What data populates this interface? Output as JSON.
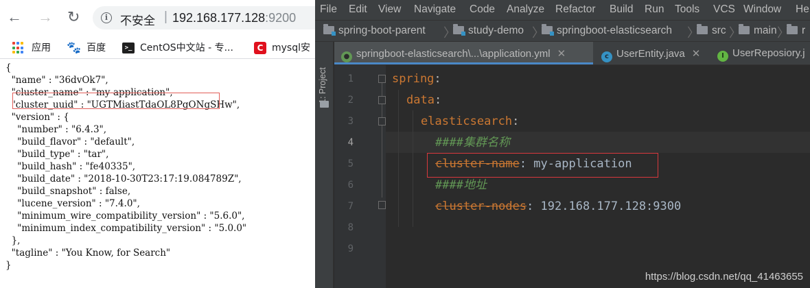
{
  "browser": {
    "nav": {
      "back": "←",
      "forward": "→",
      "reload": "↻"
    },
    "omnibox": {
      "security_label": "不安全",
      "separator": "|",
      "host": "192.168.177.128",
      "port": ":9200"
    },
    "bookmarks": [
      {
        "label": "应用",
        "icon": "apps-grid-icon"
      },
      {
        "label": "百度",
        "icon": "baidu-paw-icon"
      },
      {
        "label": "CentOS中文站 - 专...",
        "icon": "terminal-icon"
      },
      {
        "label": "mysql安",
        "icon": "csdn-icon"
      }
    ],
    "json_lines": [
      "{",
      "  \"name\" : \"36dvOk7\",",
      "  \"cluster_name\" : \"my-application\",",
      "  \"cluster_uuid\" : \"UGTMiastTdaOL8PgONgSHw\",",
      "  \"version\" : {",
      "    \"number\" : \"6.4.3\",",
      "    \"build_flavor\" : \"default\",",
      "    \"build_type\" : \"tar\",",
      "    \"build_hash\" : \"fe40335\",",
      "    \"build_date\" : \"2018-10-30T23:17:19.084789Z\",",
      "    \"build_snapshot\" : false,",
      "    \"lucene_version\" : \"7.4.0\",",
      "    \"minimum_wire_compatibility_version\" : \"5.6.0\",",
      "    \"minimum_index_compatibility_version\" : \"5.0.0\"",
      "  },",
      "  \"tagline\" : \"You Know, for Search\"",
      "}"
    ]
  },
  "ide": {
    "menu": [
      "File",
      "Edit",
      "View",
      "Navigate",
      "Code",
      "Analyze",
      "Refactor",
      "Build",
      "Run",
      "Tools",
      "VCS",
      "Window",
      "He"
    ],
    "breadcrumbs": [
      "spring-boot-parent",
      "study-demo",
      "springboot-elasticsearch",
      "src",
      "main",
      "r"
    ],
    "side_panel_label": "1: Project",
    "tabs": [
      {
        "label": "springboot-elasticsearch\\...\\application.yml",
        "icon": "yaml-icon",
        "active": true
      },
      {
        "label": "UserEntity.java",
        "icon": "class-icon",
        "active": false
      },
      {
        "label": "UserReposiory.j",
        "icon": "interface-icon",
        "active": false
      }
    ],
    "line_numbers": [
      "1",
      "2",
      "3",
      "4",
      "5",
      "6",
      "7",
      "8",
      "9"
    ],
    "code": {
      "l1_key": "spring",
      "l1_colon": ":",
      "l2_key": "data",
      "l2_colon": ":",
      "l3_key": "elasticsearch",
      "l3_colon": ":",
      "l4_comment": "####集群名称",
      "l5_key": "cluster-name",
      "l5_rest": ": my-application",
      "l6_comment": "####地址",
      "l7_key": "cluster-nodes",
      "l7_rest": ": 192.168.177.128:9300"
    },
    "watermark": "https://blog.csdn.net/qq_41463655"
  },
  "colors": {
    "highlight_box": "#e05c57",
    "yaml_key": "#cc7832",
    "yaml_comment": "#629755",
    "editor_bg": "#2b2b2b"
  }
}
